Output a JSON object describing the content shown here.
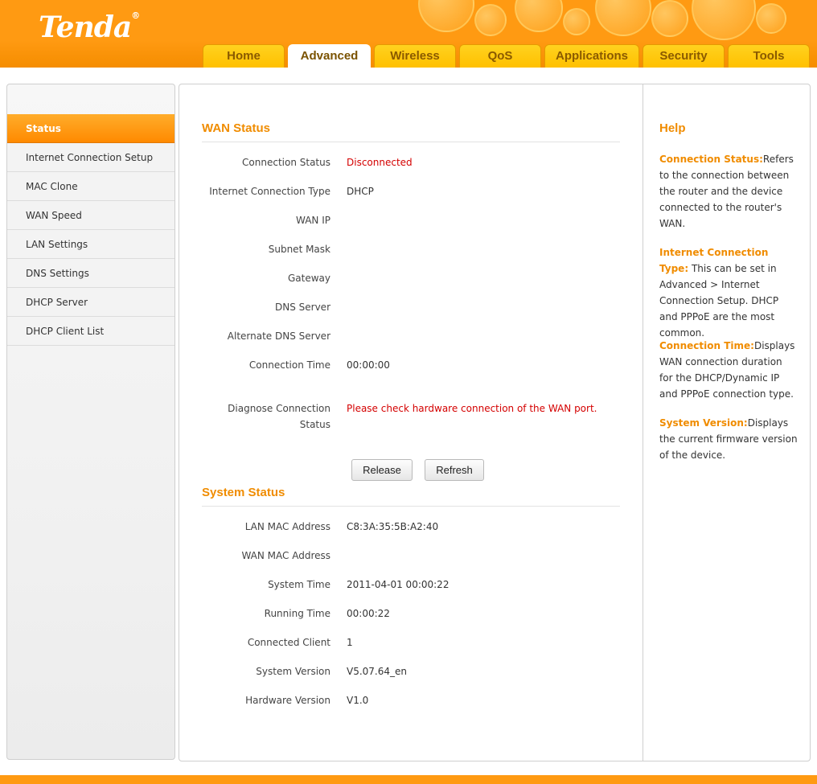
{
  "brand": {
    "logo": "Tenda",
    "registered": "®"
  },
  "nav_tabs": [
    {
      "label": "Home"
    },
    {
      "label": "Advanced",
      "active": true
    },
    {
      "label": "Wireless"
    },
    {
      "label": "QoS"
    },
    {
      "label": "Applications"
    },
    {
      "label": "Security"
    },
    {
      "label": "Tools"
    }
  ],
  "sidebar": {
    "items": [
      {
        "label": "Status",
        "active": true
      },
      {
        "label": "Internet Connection Setup"
      },
      {
        "label": "MAC Clone"
      },
      {
        "label": "WAN Speed"
      },
      {
        "label": "LAN Settings"
      },
      {
        "label": "DNS Settings"
      },
      {
        "label": "DHCP Server"
      },
      {
        "label": "DHCP Client List"
      }
    ]
  },
  "wan_status": {
    "title": "WAN Status",
    "rows": [
      {
        "label": "Connection Status",
        "value": "Disconnected"
      },
      {
        "label": "Internet Connection Type",
        "value": "DHCP"
      },
      {
        "label": "WAN IP",
        "value": ""
      },
      {
        "label": "Subnet Mask",
        "value": ""
      },
      {
        "label": "Gateway",
        "value": ""
      },
      {
        "label": "DNS Server",
        "value": ""
      },
      {
        "label": "Alternate DNS Server",
        "value": ""
      },
      {
        "label": "Connection Time",
        "value": "00:00:00"
      }
    ],
    "diagnose_label_line1": "Diagnose Connection",
    "diagnose_label_line2": "Status",
    "diagnose_value": "Please check hardware connection of the WAN port.",
    "release_label": "Release",
    "refresh_label": "Refresh"
  },
  "system_status": {
    "title": "System Status",
    "rows": [
      {
        "label": "LAN MAC Address",
        "value": "C8:3A:35:5B:A2:40"
      },
      {
        "label": "WAN MAC Address",
        "value": ""
      },
      {
        "label": "System Time",
        "value": "2011-04-01 00:00:22"
      },
      {
        "label": "Running Time",
        "value": "00:00:22"
      },
      {
        "label": "Connected Client",
        "value": "1"
      },
      {
        "label": "System Version",
        "value": "V5.07.64_en"
      },
      {
        "label": "Hardware Version",
        "value": "V1.0"
      }
    ]
  },
  "help": {
    "title": "Help",
    "entries": [
      {
        "key": "Connection Status:",
        "text": "Refers to the connection between the router and the device connected to the router's WAN."
      },
      {
        "key": "Internet Connection Type:",
        "text": "This can be set in Advanced > Internet Connection Setup. DHCP and PPPoE are the most common."
      },
      {
        "key": "Connection Time:",
        "text": "Displays WAN connection duration for the DHCP/Dynamic IP and PPPoE connection type."
      },
      {
        "key": "System Version:",
        "text": "Displays the current firmware version of the device."
      }
    ]
  },
  "colors": {
    "brand_orange": "#ff9a12",
    "accent_text": "#f08c00",
    "error_red": "#d40000"
  }
}
